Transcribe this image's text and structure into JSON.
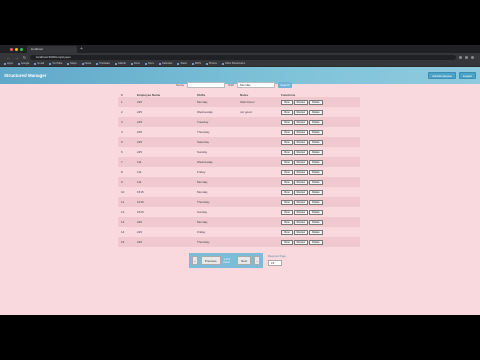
{
  "browser": {
    "tab_title": "localhost",
    "url": "localhost:3000/employees",
    "bookmarks": [
      "Apps",
      "Google",
      "Gmail",
      "YouTube",
      "Maps",
      "News",
      "Translate",
      "GitHub",
      "Drive",
      "Docs",
      "Calendar",
      "Stack",
      "MDN",
      "Photos",
      "Other Bookmarks"
    ]
  },
  "app": {
    "brand": "Structured Manager",
    "header_buttons": [
      "Add Employee",
      "Logout"
    ]
  },
  "search": {
    "name_label": "Name",
    "name_value": "",
    "shift_label": "Shift",
    "shift_value": "Monday",
    "button": "Search"
  },
  "table": {
    "headers": [
      "#",
      "Employee Name",
      "Shifts",
      "Notes",
      "Functions"
    ],
    "action_labels": [
      "View",
      "Review",
      "Delete"
    ],
    "rows": [
      {
        "id": "1",
        "name": "225",
        "shift": "Monday",
        "note": "Well Done!"
      },
      {
        "id": "2",
        "name": "225",
        "shift": "Wednesday",
        "note": "not good"
      },
      {
        "id": "3",
        "name": "225",
        "shift": "Tuesday",
        "note": ""
      },
      {
        "id": "4",
        "name": "225",
        "shift": "Thursday",
        "note": ""
      },
      {
        "id": "5",
        "name": "225",
        "shift": "Saturday",
        "note": ""
      },
      {
        "id": "6",
        "name": "225",
        "shift": "Sunday",
        "note": ""
      },
      {
        "id": "7",
        "name": "111",
        "shift": "Wednesday",
        "note": ""
      },
      {
        "id": "8",
        "name": "111",
        "shift": "Friday",
        "note": ""
      },
      {
        "id": "9",
        "name": "111",
        "shift": "Monday",
        "note": ""
      },
      {
        "id": "10",
        "name": "1515",
        "shift": "Monday",
        "note": ""
      },
      {
        "id": "11",
        "name": "1515",
        "shift": "Thursday",
        "note": ""
      },
      {
        "id": "12",
        "name": "1515",
        "shift": "Sunday",
        "note": ""
      },
      {
        "id": "13",
        "name": "226",
        "shift": "Monday",
        "note": ""
      },
      {
        "id": "14",
        "name": "226",
        "shift": "Friday",
        "note": ""
      },
      {
        "id": "15",
        "name": "226",
        "shift": "Thursday",
        "note": ""
      }
    ]
  },
  "pagination": {
    "prev_icon": "chevron-left-icon",
    "prev_label": "Previous",
    "info": "1 of 2 Items",
    "next_label": "Next",
    "next_icon": "chevron-right-icon"
  },
  "rows_per_page": {
    "label": "Rows per Page",
    "value": "15"
  },
  "colors": {
    "page_bg": "#f9d9dd",
    "row_stripe": "#efc9ce",
    "header_accent": "#5fa8c9",
    "button_accent": "#6fb3d9"
  }
}
